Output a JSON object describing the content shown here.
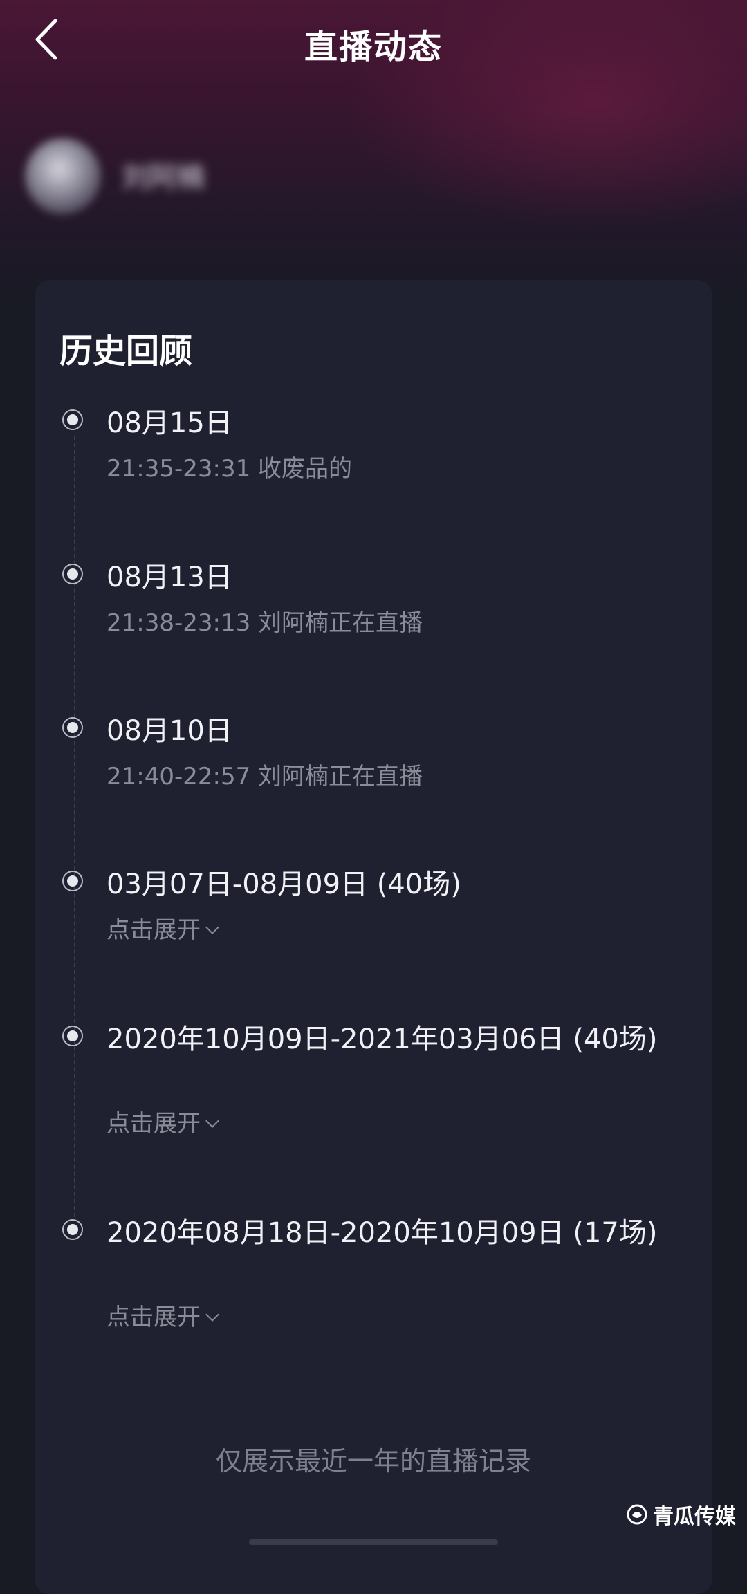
{
  "header": {
    "title": "直播动态",
    "back_icon": "chevron-left-icon"
  },
  "profile": {
    "username": "刘阿楠"
  },
  "history": {
    "title": "历史回顾",
    "items": [
      {
        "date": "08月15日",
        "detail": "21:35-23:31 收废品的"
      },
      {
        "date": "08月13日",
        "detail": "21:38-23:13 刘阿楠正在直播"
      },
      {
        "date": "08月10日",
        "detail": "21:40-22:57 刘阿楠正在直播"
      },
      {
        "date": "03月07日-08月09日 (40场)",
        "detail": "点击展开"
      },
      {
        "date": "2020年10月09日-2021年03月06日 (40场)",
        "detail": "点击展开"
      },
      {
        "date": "2020年08月18日-2020年10月09日 (17场)",
        "detail": "点击展开"
      }
    ]
  },
  "footer": {
    "note": "仅展示最近一年的直播记录"
  },
  "watermark": {
    "text": "青瓜传媒"
  },
  "colors": {
    "background": "#181a24",
    "card": "#1f2130",
    "header_gradient_top": "#4a1735",
    "primary_text": "#f2f2f6",
    "secondary_text": "#8a8c99"
  }
}
